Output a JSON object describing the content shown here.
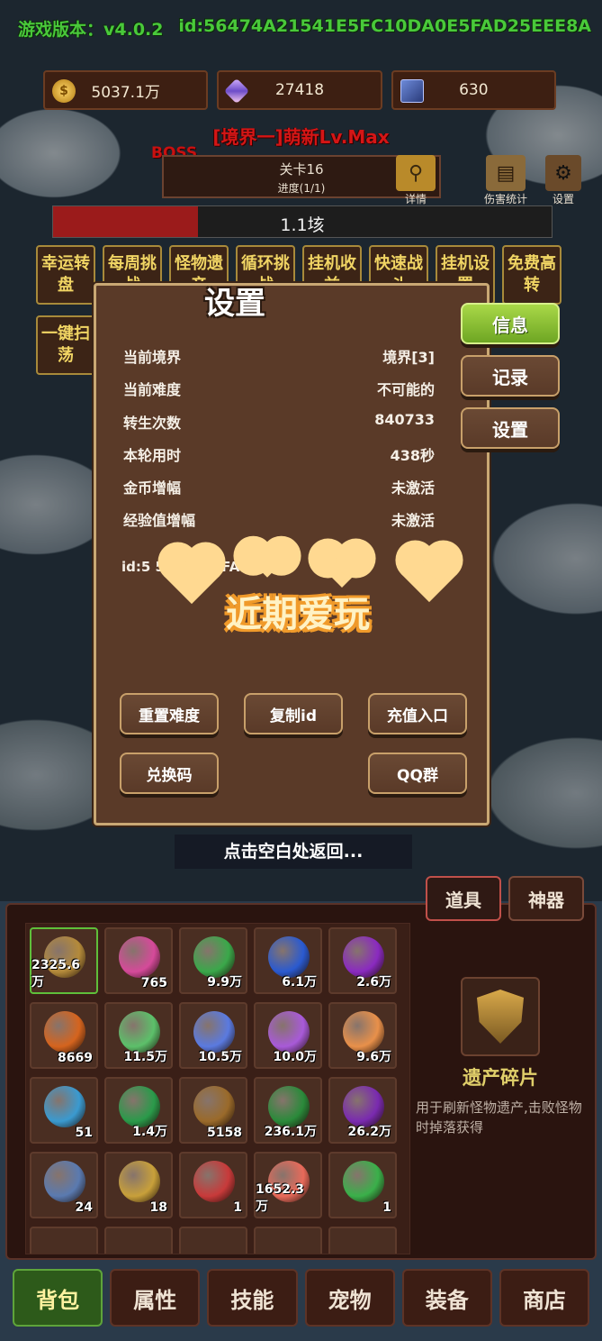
{
  "header": {
    "version": "游戏版本：v4.0.2",
    "player_id": "id:56474A21541E5FC10DA0E5FAD25EEE8A"
  },
  "resources": [
    {
      "icon": "coin-icon",
      "value": "5037.1万"
    },
    {
      "icon": "crystal-icon",
      "value": "27418"
    },
    {
      "icon": "card-icon",
      "value": "630"
    }
  ],
  "realm": {
    "title": "[境界一]萌新Lv.Max",
    "boss_label": "BOSS",
    "stage": "关卡16",
    "progress": "进度(1/1)",
    "detail_label": "详情",
    "damage_stats_label": "伤害统计",
    "settings_label": "设置",
    "hp_text": "1.1垓",
    "hp_fraction": 0.29
  },
  "function_buttons_row1": [
    "幸运转盘",
    "每周挑战",
    "怪物遗产",
    "循环挑战",
    "挂机收益",
    "快速战斗",
    "挂机设置",
    "免费高转"
  ],
  "function_buttons_row2": [
    "一键扫荡"
  ],
  "modal": {
    "title": "设置",
    "side_tabs": [
      "信息",
      "记录",
      "设置"
    ],
    "active_tab": "信息",
    "info": [
      {
        "label": "当前境界",
        "value": "境界[3]"
      },
      {
        "label": "当前难度",
        "value": "不可能的"
      },
      {
        "label": "转生次数",
        "value": "840733"
      },
      {
        "label": "本轮用时",
        "value": "438秒"
      },
      {
        "label": "金币增幅",
        "value": "未激活"
      },
      {
        "label": "经验值增幅",
        "value": "未激活"
      }
    ],
    "id_text": "id:5          541    C1          5FAD          7a",
    "watermark": "近期爱玩",
    "buttons": {
      "reset_difficulty": "重置难度",
      "copy_id": "复制id",
      "recharge": "充值入口",
      "redeem_code": "兑换码",
      "qq_group": "QQ群"
    }
  },
  "return_hint": "点击空白处返回...",
  "inventory": {
    "tabs": [
      "道具",
      "神器"
    ],
    "active_tab": "道具",
    "items": [
      {
        "name": "legacy-shard",
        "count": "2325.6万",
        "color": "#b48a3a",
        "selected": true
      },
      {
        "name": "pink-crystal",
        "count": "765",
        "color": "#d54a9a"
      },
      {
        "name": "green-orb",
        "count": "9.9万",
        "color": "#3aa84a"
      },
      {
        "name": "blue-orb",
        "count": "6.1万",
        "color": "#2a5ad0"
      },
      {
        "name": "purple-orb",
        "count": "2.6万",
        "color": "#8a2ac0"
      },
      {
        "name": "orange-orb",
        "count": "8669",
        "color": "#d5641e"
      },
      {
        "name": "green-swirl-orb",
        "count": "11.5万",
        "color": "#5cc06a"
      },
      {
        "name": "blue-swirl-orb",
        "count": "10.5万",
        "color": "#5a7ae0"
      },
      {
        "name": "purple-swirl-orb",
        "count": "10.0万",
        "color": "#a85ad8"
      },
      {
        "name": "orange-swirl-orb",
        "count": "9.6万",
        "color": "#e8904a"
      },
      {
        "name": "blue-scroll",
        "count": "51",
        "color": "#3a9ad0"
      },
      {
        "name": "green-rune",
        "count": "1.4万",
        "color": "#2a9a4a"
      },
      {
        "name": "treasure-chest",
        "count": "5158",
        "color": "#9a6a2a"
      },
      {
        "name": "green-pills",
        "count": "236.1万",
        "color": "#2a8a3a"
      },
      {
        "name": "purple-fruit",
        "count": "26.2万",
        "color": "#7a2ab0"
      },
      {
        "name": "blue-map",
        "count": "24",
        "color": "#5a7ab0"
      },
      {
        "name": "golden-gauntlet",
        "count": "18",
        "color": "#c8a03a"
      },
      {
        "name": "red-amulet",
        "count": "1",
        "color": "#c83a3a"
      },
      {
        "name": "peach-fruit",
        "count": "1652.3万",
        "color": "#e86a5a"
      },
      {
        "name": "green-potion",
        "count": "1",
        "color": "#3ab04a"
      }
    ],
    "detail": {
      "icon": "legacy-shard-icon",
      "name": "遗产碎片",
      "description": "用于刷新怪物遗产,击败怪物时掉落获得"
    }
  },
  "bottom_nav": [
    "背包",
    "属性",
    "技能",
    "宠物",
    "装备",
    "商店"
  ],
  "bottom_nav_active": "背包",
  "colors": {
    "accent_green": "#49c93a",
    "boss_red": "#d41616",
    "active_tab_green": "#8dc23a",
    "gold_text": "#f1d564"
  }
}
